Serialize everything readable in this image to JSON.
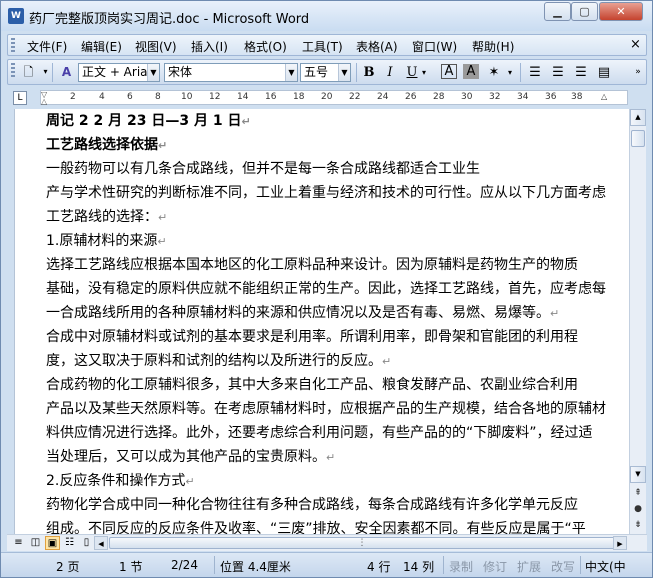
{
  "window": {
    "title": "药厂完整版顶岗实习周记.doc - Microsoft Word",
    "app_icon": "W"
  },
  "menu": {
    "items": [
      "文件(F)",
      "编辑(E)",
      "视图(V)",
      "插入(I)",
      "格式(O)",
      "工具(T)",
      "表格(A)",
      "窗口(W)",
      "帮助(H)"
    ],
    "close": "×"
  },
  "toolbar": {
    "style_value": "正文 + Aria",
    "font_value": "宋体",
    "size_value": "五号",
    "bold": "B",
    "italic": "I",
    "underline": "U"
  },
  "ruler": {
    "ticks": [
      "2",
      "4",
      "6",
      "8",
      "10",
      "12",
      "14",
      "16",
      "18",
      "20",
      "22",
      "24",
      "26",
      "28",
      "30",
      "32",
      "34",
      "36",
      "38"
    ]
  },
  "document": {
    "lines": [
      {
        "text": "周记 2    2 月 23 日—3 月 1 日",
        "bold": true
      },
      {
        "text": "工艺路线选择依据",
        "bold": true
      },
      {
        "text": "    一般药物可以有几条合成路线，但并不是每一条合成路线都适合工业生",
        "bold": false
      },
      {
        "text": "产与学术性研究的判断标准不同，工业上着重与经济和技术的可行性。应从以下几方面考虑",
        "bold": false
      },
      {
        "text": "工艺路线的选择：",
        "bold": false
      },
      {
        "text": "1.原辅材料的来源",
        "bold": false
      },
      {
        "text": "    选择工艺路线应根据本国本地区的化工原料品种来设计。因为原辅料是药物生产的物质",
        "bold": false
      },
      {
        "text": "基础，没有稳定的原料供应就不能组织正常的生产。因此，选择工艺路线，首先，应考虑每",
        "bold": false
      },
      {
        "text": "一合成路线所用的各种原辅材料的来源和供应情况以及是否有毒、易燃、易爆等。",
        "bold": false
      },
      {
        "text": "    合成中对原辅材料或试剂的基本要求是利用率。所谓利用率，即骨架和官能团的利用程",
        "bold": false
      },
      {
        "text": "度，这又取决于原料和试剂的结构以及所进行的反应。",
        "bold": false
      },
      {
        "text": "    合成药物的化工原辅料很多，其中大多来自化工产品、粮食发酵产品、农副业综合利用",
        "bold": false
      },
      {
        "text": "产品以及某些天然原料等。在考虑原辅材料时，应根据产品的生产规模，结合各地的原辅材",
        "bold": false
      },
      {
        "text": "料供应情况进行选择。此外，还要考虑综合利用问题，有些产品的的“下脚废料”，经过适",
        "bold": false
      },
      {
        "text": "当处理后，又可以成为其他产品的宝贵原料。",
        "bold": false
      },
      {
        "text": "2.反应条件和操作方式",
        "bold": false
      },
      {
        "text": "    药物化学合成中同一种化合物往往有多种合成路线，每条合成路线有许多化学单元反应",
        "bold": false
      },
      {
        "text": "组成。不同反应的反应条件及收率、“三废”排放、安全因素都不同。有些反应是属于“平",
        "bold": false
      }
    ],
    "para_mark": "↵"
  },
  "statusbar": {
    "page": "2 页",
    "section": "1 节",
    "page_of": "2/24",
    "position": "位置 4.4厘米",
    "line": "4 行",
    "column": "14 列",
    "rec": "录制",
    "trk": "修订",
    "ext": "扩展",
    "ovr": "改写",
    "lang": "中文(中"
  }
}
